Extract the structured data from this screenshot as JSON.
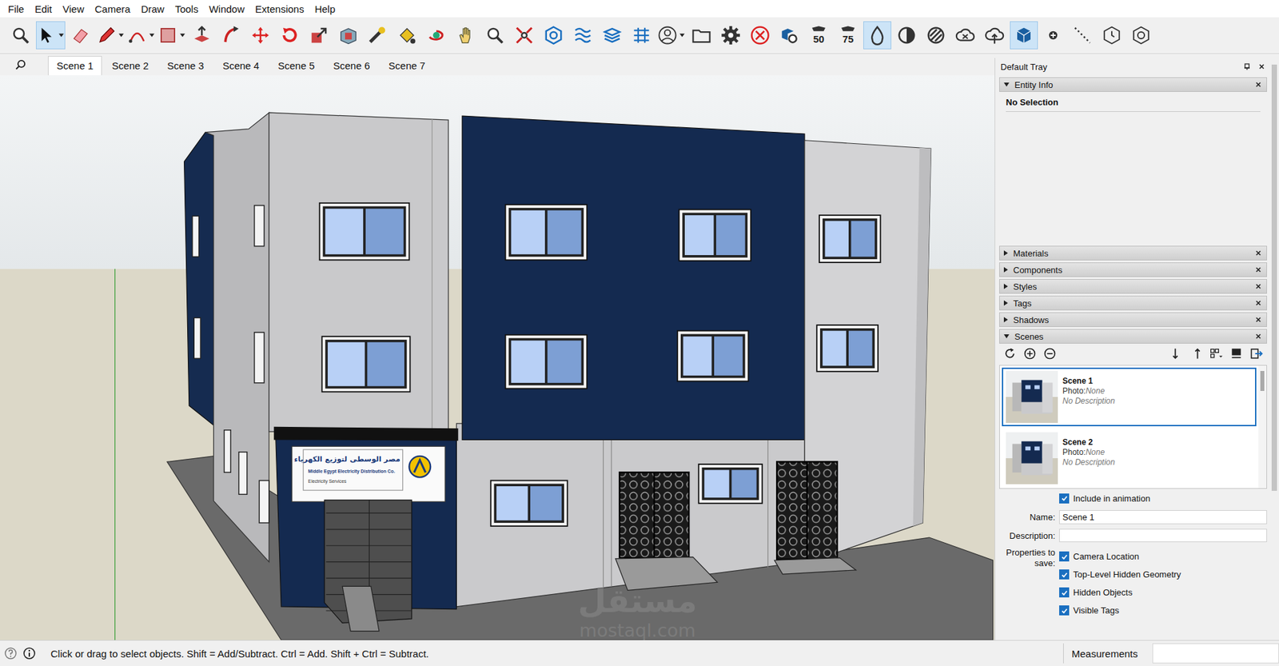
{
  "window": {
    "title": "SketchUp"
  },
  "menu": [
    "File",
    "Edit",
    "View",
    "Camera",
    "Draw",
    "Tools",
    "Window",
    "Extensions",
    "Help"
  ],
  "toolbar": [
    {
      "kind": "zoom",
      "selected": false,
      "dropdown": false
    },
    {
      "kind": "select",
      "selected": true,
      "dropdown": true
    },
    {
      "kind": "eraser",
      "selected": false,
      "dropdown": false
    },
    {
      "kind": "pencil",
      "selected": false,
      "dropdown": true
    },
    {
      "kind": "arc",
      "selected": false,
      "dropdown": true
    },
    {
      "kind": "rect",
      "selected": false,
      "dropdown": true
    },
    {
      "kind": "pushpull",
      "selected": false,
      "dropdown": false
    },
    {
      "kind": "followme",
      "selected": false,
      "dropdown": false
    },
    {
      "kind": "move",
      "selected": false,
      "dropdown": false
    },
    {
      "kind": "rotate",
      "selected": false,
      "dropdown": false
    },
    {
      "kind": "scale",
      "selected": false,
      "dropdown": false
    },
    {
      "kind": "offset",
      "selected": false,
      "dropdown": false
    },
    {
      "kind": "tape",
      "selected": false,
      "dropdown": false
    },
    {
      "kind": "paint",
      "selected": false,
      "dropdown": false
    },
    {
      "kind": "orbit",
      "selected": false,
      "dropdown": false
    },
    {
      "kind": "pan",
      "selected": false,
      "dropdown": false
    },
    {
      "kind": "zoom",
      "selected": false,
      "dropdown": false
    },
    {
      "kind": "zoomext",
      "selected": false,
      "dropdown": false
    },
    {
      "kind": "warehouse",
      "selected": false,
      "dropdown": false
    },
    {
      "kind": "layers",
      "selected": false,
      "dropdown": false
    },
    {
      "kind": "stack",
      "selected": false,
      "dropdown": false
    },
    {
      "kind": "sandbox",
      "selected": false,
      "dropdown": false
    },
    {
      "kind": "user",
      "selected": false,
      "dropdown": true
    },
    {
      "kind": "folder",
      "selected": false,
      "dropdown": false
    },
    {
      "kind": "gear",
      "selected": false,
      "dropdown": false
    },
    {
      "kind": "close",
      "selected": false,
      "dropdown": false
    },
    {
      "kind": "viewer",
      "selected": false,
      "dropdown": false
    },
    {
      "kind": "badge",
      "label": "50",
      "selected": false,
      "dropdown": false
    },
    {
      "kind": "badge",
      "label": "75",
      "selected": false,
      "dropdown": false
    },
    {
      "kind": "drop",
      "selected": true,
      "dropdown": false
    },
    {
      "kind": "half",
      "selected": false,
      "dropdown": false
    },
    {
      "kind": "hatch",
      "selected": false,
      "dropdown": false
    },
    {
      "kind": "cloud",
      "selected": false,
      "dropdown": false
    },
    {
      "kind": "cloudup",
      "selected": false,
      "dropdown": false
    },
    {
      "kind": "cube",
      "selected": true,
      "dropdown": false
    },
    {
      "kind": "dot",
      "selected": false,
      "dropdown": false
    },
    {
      "kind": "dotline",
      "selected": false,
      "dropdown": false
    },
    {
      "kind": "clock",
      "selected": false,
      "dropdown": false
    },
    {
      "kind": "hexagon",
      "selected": false,
      "dropdown": false
    }
  ],
  "scene_tabs": [
    {
      "label": "Scene 1",
      "selected": true
    },
    {
      "label": "Scene 2",
      "selected": false
    },
    {
      "label": "Scene 3",
      "selected": false
    },
    {
      "label": "Scene 4",
      "selected": false
    },
    {
      "label": "Scene 5",
      "selected": false
    },
    {
      "label": "Scene 6",
      "selected": false
    },
    {
      "label": "Scene 7",
      "selected": false
    }
  ],
  "viewport": {
    "sign": {
      "arabic": "مصر الوسطى لتوزيع الكهرباء",
      "english": "Middle Egypt Electricity Distribution Co.",
      "services": "Electricity Services"
    },
    "watermark": {
      "arabic": "مستقل",
      "latin": "mostaql.com"
    }
  },
  "tray": {
    "title": "Default Tray",
    "entity_info": {
      "title": "Entity Info",
      "expanded": true,
      "text": "No Selection"
    },
    "panels": [
      {
        "title": "Materials",
        "expanded": false
      },
      {
        "title": "Components",
        "expanded": false
      },
      {
        "title": "Styles",
        "expanded": false
      },
      {
        "title": "Tags",
        "expanded": false
      },
      {
        "title": "Shadows",
        "expanded": false
      }
    ],
    "scenes": {
      "title": "Scenes",
      "expanded": true,
      "tools": [
        "refresh",
        "add",
        "remove",
        "down",
        "up",
        "options",
        "details",
        "export"
      ],
      "list": [
        {
          "name": "Scene 1",
          "photo_label": "Photo:",
          "photo": "None",
          "description": "No Description",
          "selected": true
        },
        {
          "name": "Scene 2",
          "photo_label": "Photo:",
          "photo": "None",
          "description": "No Description",
          "selected": false
        }
      ],
      "include_animation": {
        "label": "Include in animation",
        "checked": true
      },
      "name_label": "Name:",
      "name_value": "Scene 1",
      "description_label": "Description:",
      "description_value": "",
      "properties_label": "Properties to save:",
      "properties": [
        {
          "label": "Camera Location",
          "checked": true
        },
        {
          "label": "Top-Level Hidden Geometry",
          "checked": true
        },
        {
          "label": "Hidden Objects",
          "checked": true
        },
        {
          "label": "Visible Tags",
          "checked": true
        }
      ]
    }
  },
  "status_bar": {
    "message": "Click or drag to select objects. Shift = Add/Subtract. Ctrl = Add. Shift + Ctrl = Subtract.",
    "measurements_label": "Measurements",
    "measurements_value": ""
  }
}
